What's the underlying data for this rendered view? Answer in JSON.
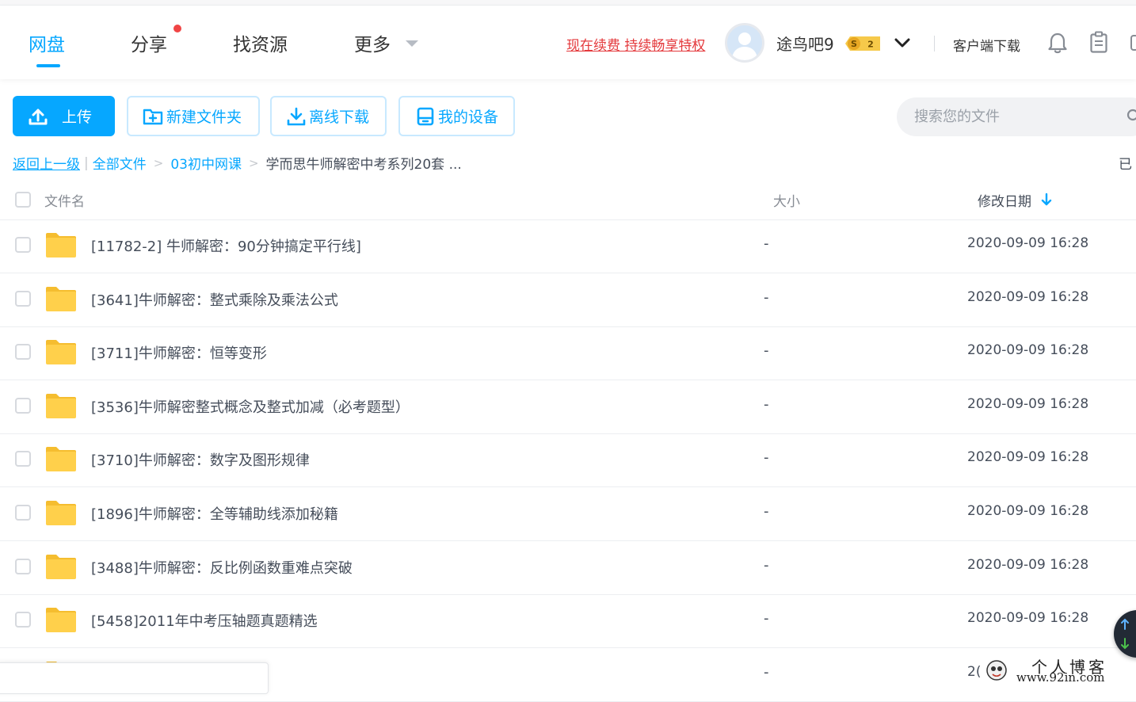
{
  "nav": {
    "items": [
      {
        "label": "网盘",
        "active": true
      },
      {
        "label": "分享",
        "has_dot": true
      },
      {
        "label": "找资源"
      },
      {
        "label": "更多"
      }
    ]
  },
  "header": {
    "renew_link": "现在续费 持续畅享特权",
    "username": "途鸟吧9",
    "vip_level": "2",
    "client_download": "客户端下载",
    "icons": [
      "chevron-down-icon",
      "bell-icon",
      "clipboard-icon"
    ]
  },
  "toolbar": {
    "upload": "上传",
    "new_folder": "新建文件夹",
    "offline_download": "离线下载",
    "my_devices": "我的设备"
  },
  "search": {
    "placeholder": "搜索您的文件"
  },
  "breadcrumb": {
    "back": "返回上一级",
    "all_files": "全部文件",
    "folder": "03初中网课",
    "current": "学而思牛师解密中考系列20套 ...",
    "loaded_status": "已"
  },
  "table": {
    "headers": {
      "name": "文件名",
      "size": "大小",
      "modified": "修改日期"
    },
    "sort": "modified-desc",
    "rows": [
      {
        "name": "[11782-2] 牛师解密：90分钟搞定平行线]",
        "size": "-",
        "modified": "2020-09-09 16:28"
      },
      {
        "name": "[3641]牛师解密：整式乘除及乘法公式",
        "size": "-",
        "modified": "2020-09-09 16:28"
      },
      {
        "name": "[3711]牛师解密：恒等变形",
        "size": "-",
        "modified": "2020-09-09 16:28"
      },
      {
        "name": "[3536]牛师解密整式概念及整式加减（必考题型）",
        "size": "-",
        "modified": "2020-09-09 16:28"
      },
      {
        "name": "[3710]牛师解密：数字及图形规律",
        "size": "-",
        "modified": "2020-09-09 16:28"
      },
      {
        "name": "[1896]牛师解密：全等辅助线添加秘籍",
        "size": "-",
        "modified": "2020-09-09 16:28"
      },
      {
        "name": "[3488]牛师解密：反比例函数重难点突破",
        "size": "-",
        "modified": "2020-09-09 16:28"
      },
      {
        "name": "[5458]2011年中考压轴题真题精选",
        "size": "-",
        "modified": "2020-09-09 16:28"
      },
      {
        "name": "",
        "size": "-",
        "modified": "2("
      }
    ]
  },
  "watermark": {
    "text": "个人博客",
    "url": "www.92in.com"
  },
  "colors": {
    "accent": "#06a7ff",
    "renew": "#e4393c",
    "folder": "#ffd04b",
    "notify_dot": "#f04545"
  }
}
